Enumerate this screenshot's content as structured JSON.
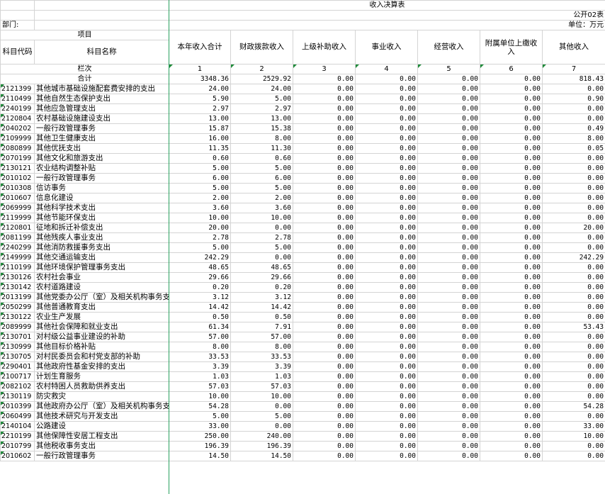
{
  "sheet": {
    "title": "收入决算表",
    "form_code": "公开02表",
    "dept_label": "部门:",
    "unit_label": "单位：万元",
    "item_group_header": "项目",
    "code_header": "科目代码",
    "name_header": "科目名称",
    "col_index_label": "栏次",
    "total_label": "合计"
  },
  "columns": [
    {
      "header": "本年收入合计",
      "index": "1"
    },
    {
      "header": "财政拨款收入",
      "index": "2"
    },
    {
      "header": "上级补助收入",
      "index": "3"
    },
    {
      "header": "事业收入",
      "index": "4"
    },
    {
      "header": "经营收入",
      "index": "5"
    },
    {
      "header": "附属单位上缴收入",
      "index": "6"
    },
    {
      "header": "其他收入",
      "index": "7"
    }
  ],
  "totals": [
    "3348.36",
    "2529.92",
    "0.00",
    "0.00",
    "0.00",
    "0.00",
    "818.43"
  ],
  "rows": [
    {
      "code": "2121399",
      "name": "其他城市基础设施配套费安排的支出",
      "v": [
        "24.00",
        "24.00",
        "0.00",
        "0.00",
        "0.00",
        "0.00",
        "0.00"
      ]
    },
    {
      "code": "2110499",
      "name": "其他自然生态保护支出",
      "v": [
        "5.90",
        "5.00",
        "0.00",
        "0.00",
        "0.00",
        "0.00",
        "0.90"
      ]
    },
    {
      "code": "2240199",
      "name": "其他应急管理支出",
      "v": [
        "2.97",
        "2.97",
        "0.00",
        "0.00",
        "0.00",
        "0.00",
        "0.00"
      ]
    },
    {
      "code": "2120804",
      "name": "农村基础设施建设支出",
      "v": [
        "13.00",
        "13.00",
        "0.00",
        "0.00",
        "0.00",
        "0.00",
        "0.00"
      ]
    },
    {
      "code": "2040202",
      "name": "一般行政管理事务",
      "v": [
        "15.87",
        "15.38",
        "0.00",
        "0.00",
        "0.00",
        "0.00",
        "0.49"
      ]
    },
    {
      "code": "2109999",
      "name": "其他卫生健康支出",
      "v": [
        "16.00",
        "8.00",
        "0.00",
        "0.00",
        "0.00",
        "0.00",
        "8.00"
      ]
    },
    {
      "code": "2080899",
      "name": "其他优抚支出",
      "v": [
        "11.35",
        "11.30",
        "0.00",
        "0.00",
        "0.00",
        "0.00",
        "0.05"
      ]
    },
    {
      "code": "2070199",
      "name": "其他文化和旅游支出",
      "v": [
        "0.60",
        "0.60",
        "0.00",
        "0.00",
        "0.00",
        "0.00",
        "0.00"
      ]
    },
    {
      "code": "2130121",
      "name": "农业结构调整补贴",
      "v": [
        "5.00",
        "5.00",
        "0.00",
        "0.00",
        "0.00",
        "0.00",
        "0.00"
      ]
    },
    {
      "code": "2010102",
      "name": "一般行政管理事务",
      "v": [
        "6.00",
        "6.00",
        "0.00",
        "0.00",
        "0.00",
        "0.00",
        "0.00"
      ]
    },
    {
      "code": "2010308",
      "name": "信访事务",
      "v": [
        "5.00",
        "5.00",
        "0.00",
        "0.00",
        "0.00",
        "0.00",
        "0.00"
      ]
    },
    {
      "code": "2010607",
      "name": "信息化建设",
      "v": [
        "2.00",
        "2.00",
        "0.00",
        "0.00",
        "0.00",
        "0.00",
        "0.00"
      ]
    },
    {
      "code": "2069999",
      "name": "其他科学技术支出",
      "v": [
        "3.60",
        "3.60",
        "0.00",
        "0.00",
        "0.00",
        "0.00",
        "0.00"
      ]
    },
    {
      "code": "2119999",
      "name": "其他节能环保支出",
      "v": [
        "10.00",
        "10.00",
        "0.00",
        "0.00",
        "0.00",
        "0.00",
        "0.00"
      ]
    },
    {
      "code": "2120801",
      "name": "征地和拆迁补偿支出",
      "v": [
        "20.00",
        "0.00",
        "0.00",
        "0.00",
        "0.00",
        "0.00",
        "20.00"
      ]
    },
    {
      "code": "2081199",
      "name": "其他残疾人事业支出",
      "v": [
        "2.78",
        "2.78",
        "0.00",
        "0.00",
        "0.00",
        "0.00",
        "0.00"
      ]
    },
    {
      "code": "2240299",
      "name": "其他消防救援事务支出",
      "v": [
        "5.00",
        "5.00",
        "0.00",
        "0.00",
        "0.00",
        "0.00",
        "0.00"
      ]
    },
    {
      "code": "2149999",
      "name": "其他交通运输支出",
      "v": [
        "242.29",
        "0.00",
        "0.00",
        "0.00",
        "0.00",
        "0.00",
        "242.29"
      ]
    },
    {
      "code": "2110199",
      "name": "其他环境保护管理事务支出",
      "v": [
        "48.65",
        "48.65",
        "0.00",
        "0.00",
        "0.00",
        "0.00",
        "0.00"
      ]
    },
    {
      "code": "2130126",
      "name": "农村社会事业",
      "v": [
        "29.66",
        "29.66",
        "0.00",
        "0.00",
        "0.00",
        "0.00",
        "0.00"
      ]
    },
    {
      "code": "2130142",
      "name": "农村道路建设",
      "v": [
        "0.20",
        "0.20",
        "0.00",
        "0.00",
        "0.00",
        "0.00",
        "0.00"
      ]
    },
    {
      "code": "2013199",
      "name": "其他党委办公厅（室）及相关机构事务支",
      "v": [
        "3.12",
        "3.12",
        "0.00",
        "0.00",
        "0.00",
        "0.00",
        "0.00"
      ]
    },
    {
      "code": "2050299",
      "name": "其他普通教育支出",
      "v": [
        "14.42",
        "14.42",
        "0.00",
        "0.00",
        "0.00",
        "0.00",
        "0.00"
      ]
    },
    {
      "code": "2130122",
      "name": "农业生产发展",
      "v": [
        "0.50",
        "0.50",
        "0.00",
        "0.00",
        "0.00",
        "0.00",
        "0.00"
      ]
    },
    {
      "code": "2089999",
      "name": "其他社会保障和就业支出",
      "v": [
        "61.34",
        "7.91",
        "0.00",
        "0.00",
        "0.00",
        "0.00",
        "53.43"
      ]
    },
    {
      "code": "2130701",
      "name": "对村级公益事业建设的补助",
      "v": [
        "57.00",
        "57.00",
        "0.00",
        "0.00",
        "0.00",
        "0.00",
        "0.00"
      ]
    },
    {
      "code": "2130999",
      "name": "其他目标价格补贴",
      "v": [
        "8.00",
        "8.00",
        "0.00",
        "0.00",
        "0.00",
        "0.00",
        "0.00"
      ]
    },
    {
      "code": "2130705",
      "name": "对村民委员会和村党支部的补助",
      "v": [
        "33.53",
        "33.53",
        "0.00",
        "0.00",
        "0.00",
        "0.00",
        "0.00"
      ]
    },
    {
      "code": "2290401",
      "name": "其他政府性基金安排的支出",
      "v": [
        "3.39",
        "3.39",
        "0.00",
        "0.00",
        "0.00",
        "0.00",
        "0.00"
      ]
    },
    {
      "code": "2100717",
      "name": "计划生育服务",
      "v": [
        "1.03",
        "1.03",
        "0.00",
        "0.00",
        "0.00",
        "0.00",
        "0.00"
      ]
    },
    {
      "code": "2082102",
      "name": "农村特困人员救助供养支出",
      "v": [
        "57.03",
        "57.03",
        "0.00",
        "0.00",
        "0.00",
        "0.00",
        "0.00"
      ]
    },
    {
      "code": "2130119",
      "name": "防灾救灾",
      "v": [
        "10.00",
        "10.00",
        "0.00",
        "0.00",
        "0.00",
        "0.00",
        "0.00"
      ]
    },
    {
      "code": "2010399",
      "name": "其他政府办公厅（室）及相关机构事务支",
      "v": [
        "54.28",
        "0.00",
        "0.00",
        "0.00",
        "0.00",
        "0.00",
        "54.28"
      ]
    },
    {
      "code": "2060499",
      "name": "其他技术研究与开发支出",
      "v": [
        "5.00",
        "5.00",
        "0.00",
        "0.00",
        "0.00",
        "0.00",
        "0.00"
      ]
    },
    {
      "code": "2140104",
      "name": "公路建设",
      "v": [
        "33.00",
        "0.00",
        "0.00",
        "0.00",
        "0.00",
        "0.00",
        "33.00"
      ]
    },
    {
      "code": "2210199",
      "name": "其他保障性安居工程支出",
      "v": [
        "250.00",
        "240.00",
        "0.00",
        "0.00",
        "0.00",
        "0.00",
        "10.00"
      ]
    },
    {
      "code": "2010799",
      "name": "其他税收事务支出",
      "v": [
        "196.39",
        "196.39",
        "0.00",
        "0.00",
        "0.00",
        "0.00",
        "0.00"
      ]
    },
    {
      "code": "2010602",
      "name": "一般行政管理事务",
      "v": [
        "14.50",
        "14.50",
        "0.00",
        "0.00",
        "0.00",
        "0.00",
        "0.00"
      ]
    }
  ]
}
